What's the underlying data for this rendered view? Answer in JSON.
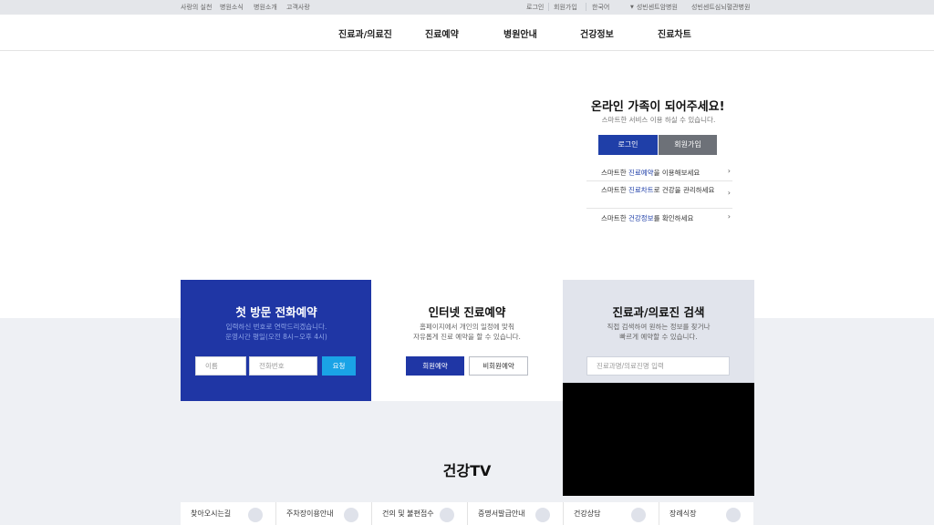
{
  "topbar": {
    "left_links": [
      "사랑의 실천",
      "병원소식",
      "병원소개",
      "고객사랑"
    ],
    "login": "로그인",
    "join": "회원가입",
    "language": "한국어",
    "hospital_select": "성빈센트암병원",
    "hospital_link": "성빈센트심뇌혈관병원"
  },
  "gnb": {
    "menus": [
      "진료과/의료진",
      "진료예약",
      "병원안내",
      "건강정보",
      "진료차트"
    ]
  },
  "login_panel": {
    "title": "온라인 가족이 되어주세요!",
    "subtitle": "스마트한 서비스 이용 하실 수 있습니다.",
    "login_button": "로그인",
    "join_button": "회원가입",
    "links": [
      {
        "pre": "스마트한 ",
        "hl": "진료예약",
        "post": "을 이용해보세요"
      },
      {
        "pre": "스마트한 ",
        "hl": "진료차트",
        "post": "로 건강을 관리하세요"
      },
      {
        "pre": "스마트한 ",
        "hl": "건강정보",
        "post": "를 확인하세요"
      }
    ]
  },
  "cards": {
    "phone": {
      "title": "첫 방문 전화예약",
      "desc1": "입력하신 번호로 연락드리겠습니다.",
      "desc2": "운영시간 평일(오전 8시~오후 4시)",
      "name_placeholder": "이름",
      "phone_placeholder": "전화번호",
      "request_button": "요청"
    },
    "internet": {
      "title": "인터넷 진료예약",
      "desc1": "홈페이지에서 개인의 일정에 맞춰",
      "desc2": "자유롭게 진료 예약을 할 수 있습니다.",
      "member_button": "회원예약",
      "guest_button": "비회원예약"
    },
    "search": {
      "title": "진료과/의료진 검색",
      "desc1": "직접 검색하여 원하는 정보를 찾거나",
      "desc2": "빠르게 예약할 수 있습니다.",
      "placeholder": "진료과명/의료진명 입력"
    }
  },
  "tv": {
    "title": "건강TV"
  },
  "quick_menu": [
    "찾아오시는길",
    "주차장이용안내",
    "건의 및 불편접수",
    "증명서발급안내",
    "건강상담",
    "장례식장"
  ],
  "colors": {
    "brand_blue": "#1f36a5",
    "accent_cyan": "#1aa3e6",
    "join_gray": "#6d7178"
  }
}
